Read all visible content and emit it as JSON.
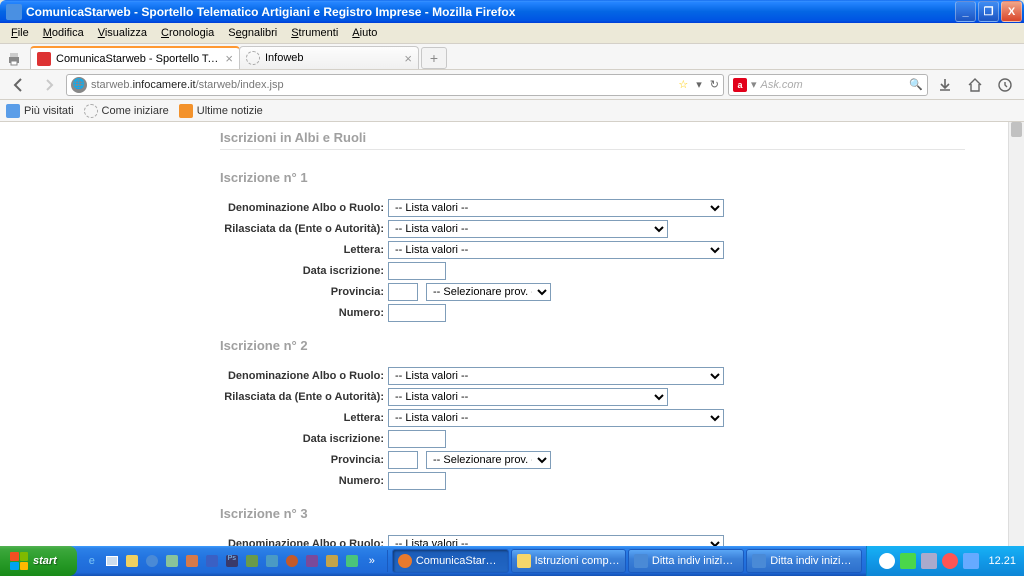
{
  "window": {
    "title": "ComunicaStarweb - Sportello Telematico Artigiani e Registro Imprese - Mozilla Firefox"
  },
  "menubar": [
    "File",
    "Modifica",
    "Visualizza",
    "Cronologia",
    "Segnalibri",
    "Strumenti",
    "Aiuto"
  ],
  "tabs": [
    {
      "label": "ComunicaStarweb - Sportello Telematico ...",
      "active": true
    },
    {
      "label": "Infoweb",
      "active": false
    }
  ],
  "urlbar": {
    "host": "infocamere.it",
    "prefix": "starweb.",
    "path": "/starweb/index.jsp"
  },
  "searchbar": {
    "engine": "Ask.com",
    "placeholder": "Ask.com"
  },
  "bookmarks": [
    {
      "label": "Più visitati"
    },
    {
      "label": "Come iniziare"
    },
    {
      "label": "Ultime notizie"
    }
  ],
  "page": {
    "section_title": "Iscrizioni in Albi e Ruoli",
    "iscrizioni": [
      {
        "title": "Iscrizione n° 1"
      },
      {
        "title": "Iscrizione n° 2"
      },
      {
        "title": "Iscrizione n° 3"
      }
    ],
    "labels": {
      "denominazione": "Denominazione Albo o Ruolo",
      "rilasciata": "Rilasciata da (Ente o Autorità)",
      "lettera": "Lettera",
      "data": "Data iscrizione",
      "provincia": "Provincia",
      "numero": "Numero"
    },
    "select_placeholder": "-- Lista valori --",
    "prov_placeholder": "-- Selezionare prov. --"
  },
  "taskbar": {
    "start": "start",
    "items": [
      {
        "label": "ComunicaStarweb - S...",
        "active": true,
        "color": "#e77a2e"
      },
      {
        "label": "Istruzioni compilazion...",
        "active": false,
        "color": "#f5d66b"
      },
      {
        "label": "Ditta indiv inizio press...",
        "active": false,
        "color": "#4a8ad6"
      },
      {
        "label": "Ditta indiv inizio press...",
        "active": false,
        "color": "#4a8ad6"
      }
    ],
    "clock": "12.21"
  }
}
